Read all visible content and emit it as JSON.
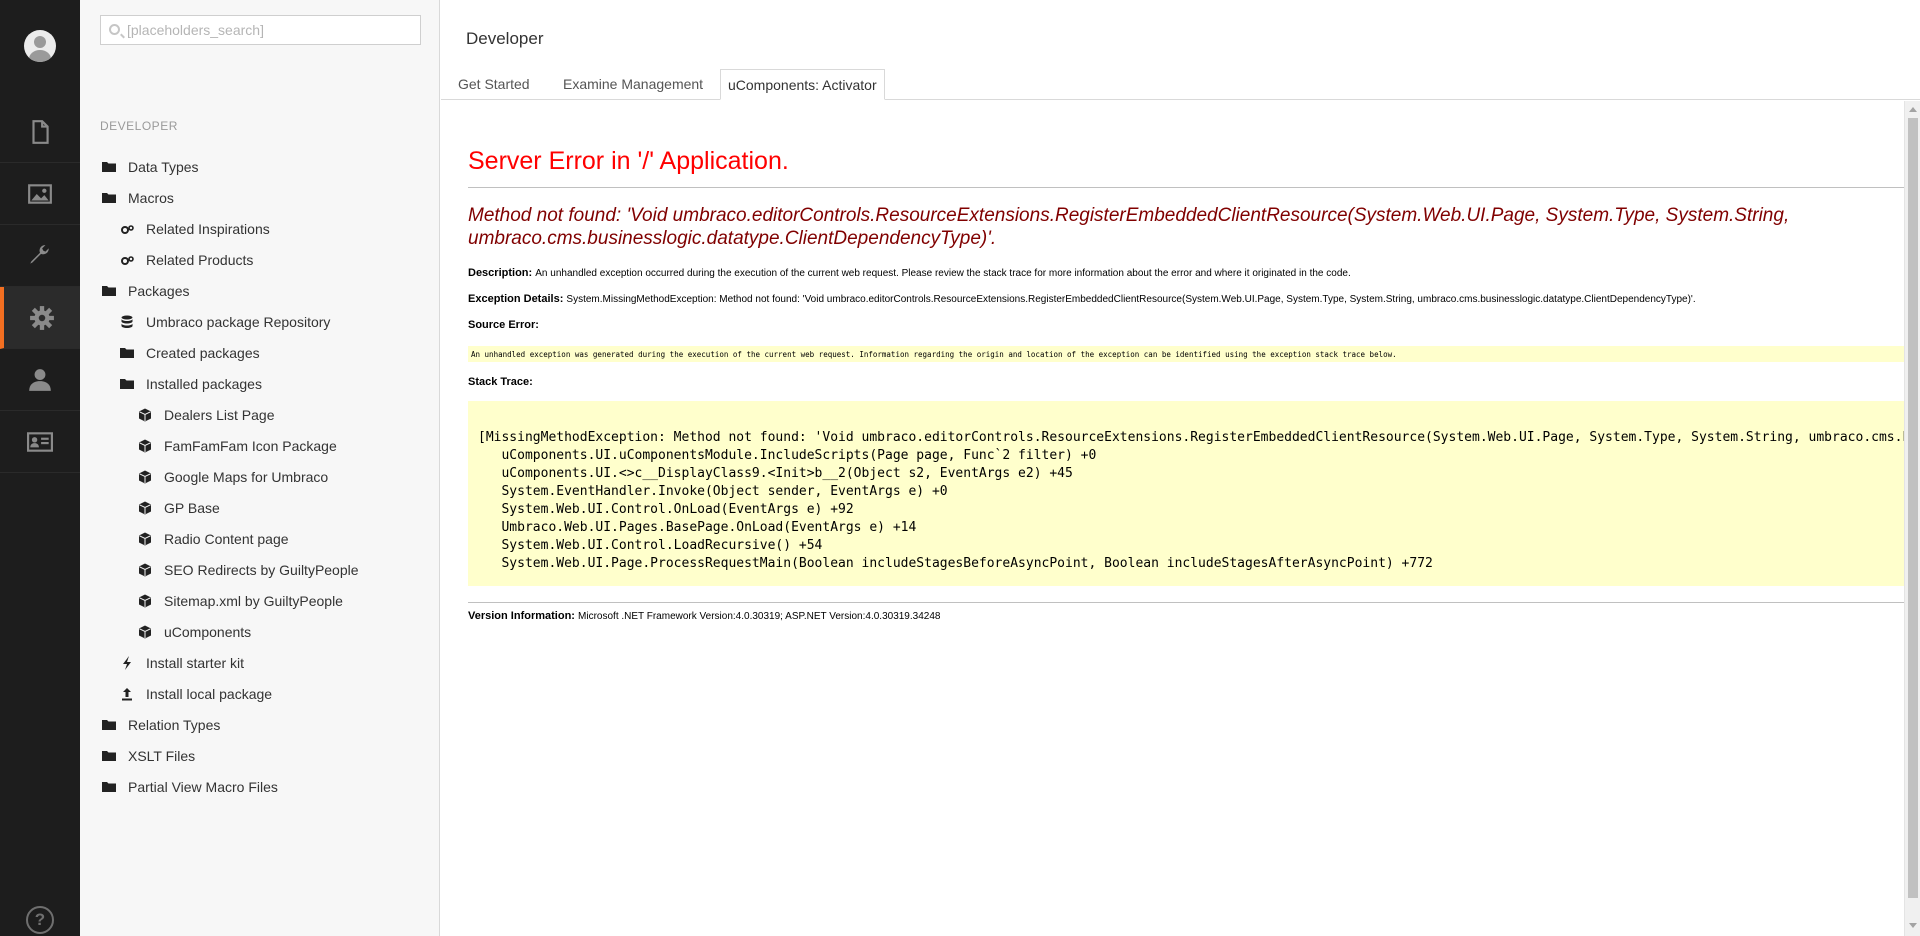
{
  "search": {
    "placeholder": "[placeholders_search]"
  },
  "rail": {
    "items": [
      {
        "icon": "document-icon"
      },
      {
        "icon": "image-icon"
      },
      {
        "icon": "wrench-icon"
      },
      {
        "icon": "gear-icon",
        "active": true
      },
      {
        "icon": "user-icon"
      },
      {
        "icon": "id-card-icon"
      }
    ],
    "help_label": "?"
  },
  "tree": {
    "section": "DEVELOPER",
    "nodes": [
      {
        "label": "Data Types",
        "icon": "folder-icon"
      },
      {
        "label": "Macros",
        "icon": "folder-icon"
      },
      {
        "label": "Related Inspirations",
        "icon": "cogs-icon"
      },
      {
        "label": "Related Products",
        "icon": "cogs-icon"
      },
      {
        "label": "Packages",
        "icon": "folder-icon"
      },
      {
        "label": "Umbraco package Repository",
        "icon": "database-icon"
      },
      {
        "label": "Created packages",
        "icon": "folder-icon"
      },
      {
        "label": "Installed packages",
        "icon": "folder-icon"
      },
      {
        "label": "Dealers List Page",
        "icon": "box-icon"
      },
      {
        "label": "FamFamFam Icon Package",
        "icon": "box-icon"
      },
      {
        "label": "Google Maps for Umbraco",
        "icon": "box-icon"
      },
      {
        "label": "GP Base",
        "icon": "box-icon"
      },
      {
        "label": "Radio Content page",
        "icon": "box-icon"
      },
      {
        "label": "SEO Redirects by GuiltyPeople",
        "icon": "box-icon"
      },
      {
        "label": "Sitemap.xml by GuiltyPeople",
        "icon": "box-icon"
      },
      {
        "label": "uComponents",
        "icon": "box-icon"
      },
      {
        "label": "Install starter kit",
        "icon": "bolt-icon"
      },
      {
        "label": "Install local package",
        "icon": "upload-icon"
      },
      {
        "label": "Relation Types",
        "icon": "folder-icon"
      },
      {
        "label": "XSLT Files",
        "icon": "folder-icon"
      },
      {
        "label": "Partial View Macro Files",
        "icon": "folder-icon"
      }
    ]
  },
  "header": {
    "title": "Developer",
    "tabs": [
      {
        "label": "Get Started"
      },
      {
        "label": "Examine Management"
      },
      {
        "label": "uComponents: Activator",
        "active": true
      }
    ]
  },
  "error": {
    "title": "Server Error in '/' Application.",
    "message": "Method not found: 'Void umbraco.editorControls.ResourceExtensions.RegisterEmbeddedClientResource(System.Web.UI.Page, System.Type, System.String, umbraco.cms.businesslogic.datatype.ClientDependencyType)'.",
    "description_label": "Description:",
    "description": "An unhandled exception occurred during the execution of the current web request. Please review the stack trace for more information about the error and where it originated in the code.",
    "exception_label": "Exception Details:",
    "exception": "System.MissingMethodException: Method not found: 'Void umbraco.editorControls.ResourceExtensions.RegisterEmbeddedClientResource(System.Web.UI.Page, System.Type, System.String, umbraco.cms.businesslogic.datatype.ClientDependencyType)'.",
    "source_label": "Source Error:",
    "source": "An unhandled exception was generated during the execution of the current web request. Information regarding the origin and location of the exception can be identified using the exception stack trace below.",
    "stack_label": "Stack Trace:",
    "stack": [
      "[MissingMethodException: Method not found: 'Void umbraco.editorControls.ResourceExtensions.RegisterEmbeddedClientResource(System.Web.UI.Page, System.Type, System.String, umbraco.cms.businesslogic.datatype.ClientDependencyType)'.]",
      "   uComponents.UI.uComponentsModule.IncludeScripts(Page page, Func`2 filter) +0",
      "   uComponents.UI.<>c__DisplayClass9.<Init>b__2(Object s2, EventArgs e2) +45",
      "   System.EventHandler.Invoke(Object sender, EventArgs e) +0",
      "   System.Web.UI.Control.OnLoad(EventArgs e) +92",
      "   Umbraco.Web.UI.Pages.BasePage.OnLoad(EventArgs e) +14",
      "   System.Web.UI.Control.LoadRecursive() +54",
      "   System.Web.UI.Page.ProcessRequestMain(Boolean includeStagesBeforeAsyncPoint, Boolean includeStagesAfterAsyncPoint) +772"
    ],
    "version_label": "Version Information:",
    "version": "Microsoft .NET Framework Version:4.0.30319; ASP.NET Version:4.0.30319.34248"
  },
  "colors": {
    "rail_bg": "#1d1d1d",
    "accent": "#f36f21",
    "error_title": "#ff0000",
    "error_message": "#800000",
    "code_bg": "#ffffcc"
  }
}
